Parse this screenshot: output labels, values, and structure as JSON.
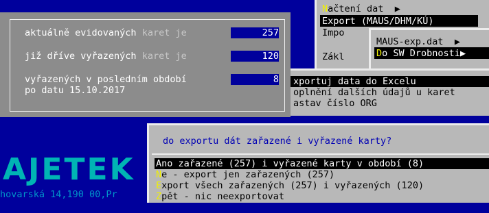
{
  "top_menu": {
    "items": [
      {
        "hot": "N",
        "rest": "ačtení dat",
        "arrow": "▶"
      },
      {
        "hot": "",
        "rest": "Export (MAUS/DHM/KÚ)",
        "arrow": ""
      },
      {
        "hot": "",
        "rest": "Impo",
        "arrow": ""
      },
      {
        "hot": "",
        "rest": "Zákl",
        "arrow": ""
      }
    ]
  },
  "submenu": {
    "items": [
      {
        "hot": "",
        "rest": "MAUS-exp.dat",
        "arrow": "▶"
      },
      {
        "hot": "D",
        "rest": "o SW Drobnosti",
        "arrow": "▶"
      }
    ]
  },
  "export_menu": {
    "items": [
      {
        "rest": "xportuj data do Excelu"
      },
      {
        "rest": "oplnění dalších údajů u karet"
      },
      {
        "rest": "astav číslo ORG"
      }
    ]
  },
  "info_dialog": {
    "rows": [
      {
        "label": "aktuálně evidovaných ",
        "dim": "karet je",
        "value": "257"
      },
      {
        "label": "již dříve vyřazených ",
        "dim": "karet je",
        "value": "120"
      },
      {
        "label": "vyřazených v posledním období",
        "dim": "",
        "value": "8"
      }
    ],
    "date_line": "po datu 15.10.2017"
  },
  "logo": {
    "text": "AJETEK",
    "address": "hovarská 14,190 00,Pr"
  },
  "question_dialog": {
    "question": "do exportu dát zařazené i vyřazené karty?",
    "options": [
      {
        "hot": "",
        "rest": "Ano zařazené (257) i vyřazené karty v období (8)"
      },
      {
        "hot": "N",
        "rest": "e - export jen zařazených (257)"
      },
      {
        "hot": "E",
        "rest": "xport všech zařazených (257) i vyřazených (120)"
      },
      {
        "hot": "Z",
        "rest": "pět - nic neexportovat"
      }
    ]
  },
  "colors": {
    "background": "#00009c",
    "dialog_gray": "#b8b8b8",
    "info_gray": "#8c8c8c",
    "hotkey": "#f0f000",
    "question_text": "#0000b4"
  }
}
